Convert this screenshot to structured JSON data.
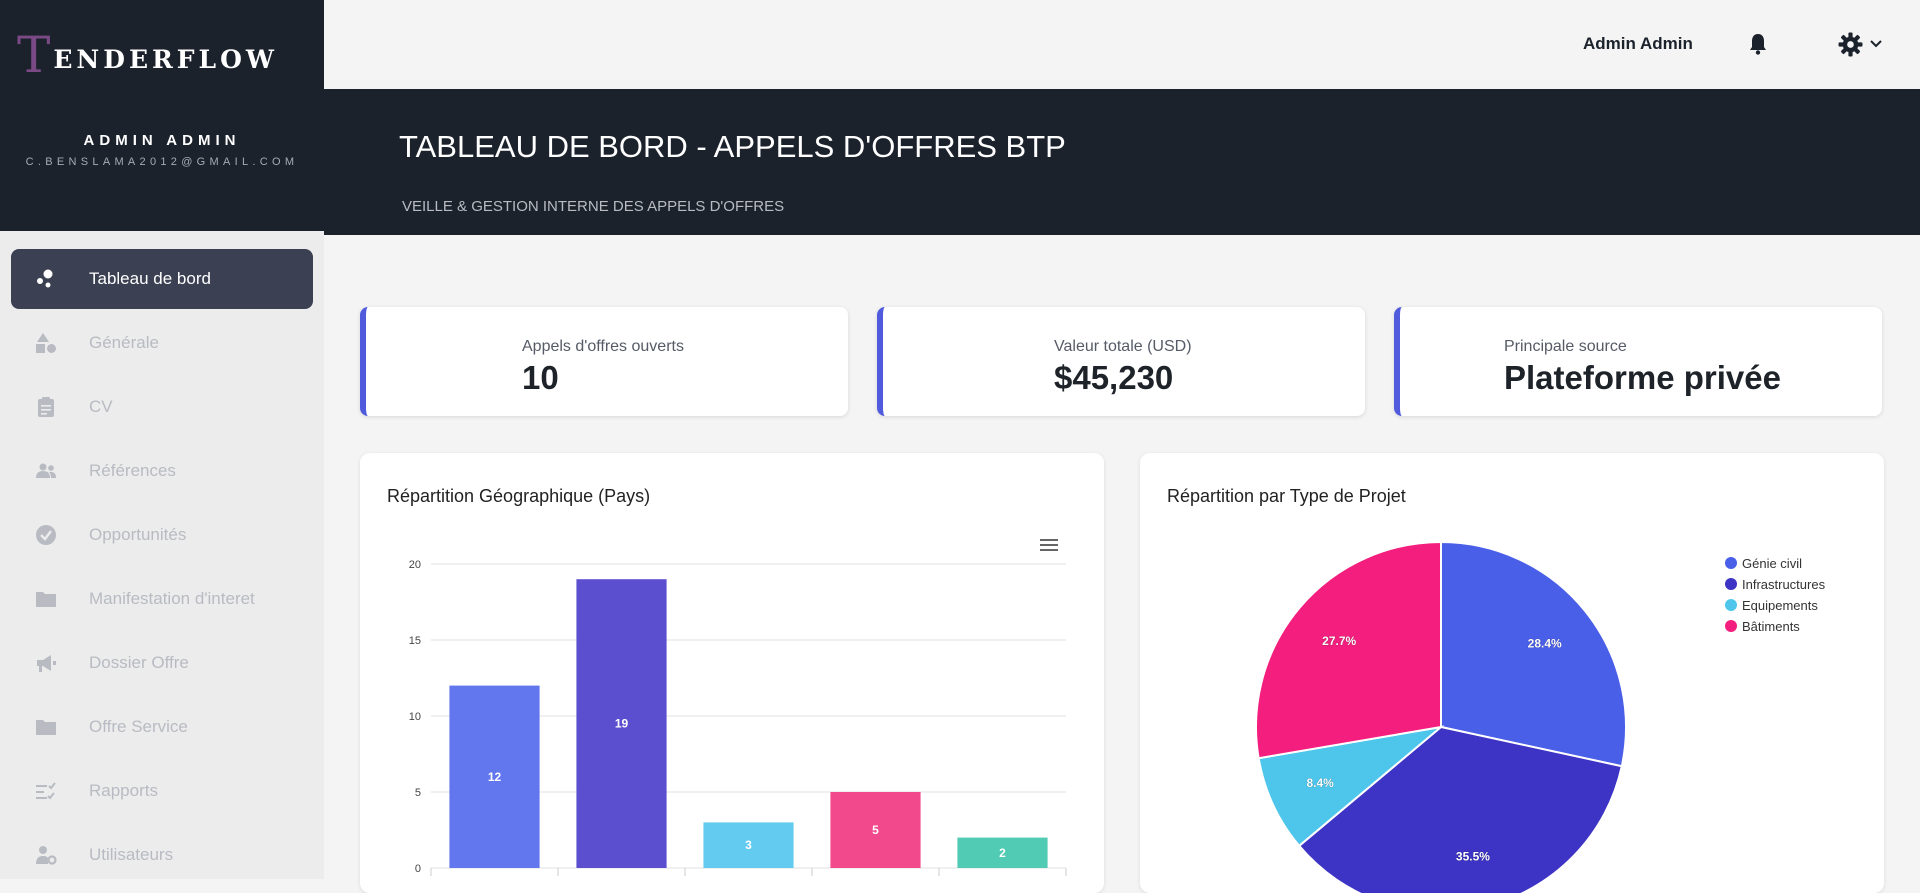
{
  "brand": {
    "letter": "T",
    "rest": "ENDERFLOW",
    "user_name": "ADMIN ADMIN",
    "user_email": "C.BENSLAMA2012@GMAIL.COM"
  },
  "sidebar": {
    "items": [
      {
        "label": "Tableau de bord",
        "icon": "dashboard-icon",
        "active": true
      },
      {
        "label": "Générale",
        "icon": "shapes-icon",
        "active": false
      },
      {
        "label": "CV",
        "icon": "clipboard-icon",
        "active": false
      },
      {
        "label": "Références",
        "icon": "users-icon",
        "active": false
      },
      {
        "label": "Opportunités",
        "icon": "check-circle-icon",
        "active": false
      },
      {
        "label": "Manifestation d'interet",
        "icon": "folder-icon",
        "active": false
      },
      {
        "label": "Dossier Offre",
        "icon": "megaphone-icon",
        "active": false
      },
      {
        "label": "Offre Service",
        "icon": "folder-icon",
        "active": false
      },
      {
        "label": "Rapports",
        "icon": "checklist-icon",
        "active": false
      },
      {
        "label": "Utilisateurs",
        "icon": "user-cog-icon",
        "active": false
      }
    ]
  },
  "topbar": {
    "username": "Admin Admin",
    "notification_icon": "bell-icon",
    "settings_icon": "gear-icon"
  },
  "header": {
    "title": "TABLEAU DE BORD - APPELS D'OFFRES BTP",
    "subtitle": "VEILLE & GESTION INTERNE DES APPELS D'OFFRES"
  },
  "stats": [
    {
      "label": "Appels d'offres ouverts",
      "value": "10"
    },
    {
      "label": "Valeur totale (USD)",
      "value": "$45,230"
    },
    {
      "label": "Principale source",
      "value": "Plateforme privée"
    }
  ],
  "colors": {
    "accent": "#4f5bdc",
    "dark": "#1c222c"
  },
  "chart_data": [
    {
      "type": "bar",
      "title": "Répartition Géographique (Pays)",
      "categories": [
        "",
        "",
        "",
        "",
        ""
      ],
      "values": [
        12,
        19,
        3,
        5,
        2
      ],
      "colors": [
        "#6277ee",
        "#5c4fcf",
        "#63cbef",
        "#f2498d",
        "#52cbb4"
      ],
      "ylim": [
        0,
        20
      ],
      "yticks": [
        0,
        5,
        10,
        15,
        20
      ],
      "grid": true
    },
    {
      "type": "pie",
      "title": "Répartition par Type de Projet",
      "legend_position": "top-right",
      "slices": [
        {
          "name": "Génie civil",
          "value": 28.4,
          "label": "28.4%",
          "color": "#4a5fe8"
        },
        {
          "name": "Infrastructures",
          "value": 35.5,
          "label": "35.5%",
          "color": "#3d33c4"
        },
        {
          "name": "Equipements",
          "value": 8.4,
          "label": "8.4%",
          "color": "#4ec6ec"
        },
        {
          "name": "Bâtiments",
          "value": 27.7,
          "label": "27.7%",
          "color": "#f31e7d"
        }
      ]
    }
  ]
}
